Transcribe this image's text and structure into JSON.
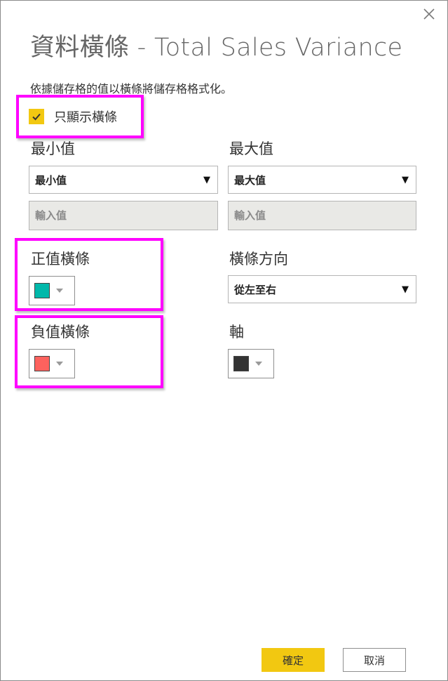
{
  "dialog": {
    "title": "資料橫條 - Total Sales Variance",
    "description": "依據儲存格的值以橫條將儲存格格式化。",
    "close_icon": "close-icon"
  },
  "show_bar_only": {
    "label": "只顯示橫條",
    "checked": true
  },
  "minimum": {
    "label": "最小值",
    "selected": "最小值",
    "input_placeholder": "輸入值"
  },
  "maximum": {
    "label": "最大值",
    "selected": "最大值",
    "input_placeholder": "輸入值"
  },
  "positive_bar": {
    "label": "正值橫條",
    "color": "#01b8aa"
  },
  "bar_direction": {
    "label": "橫條方向",
    "selected": "從左至右"
  },
  "negative_bar": {
    "label": "負值橫條",
    "color": "#fd625e"
  },
  "axis": {
    "label": "軸",
    "color": "#333333"
  },
  "buttons": {
    "ok": "確定",
    "cancel": "取消"
  },
  "colors": {
    "accent": "#f2c811",
    "highlight": "#ff00ff"
  }
}
